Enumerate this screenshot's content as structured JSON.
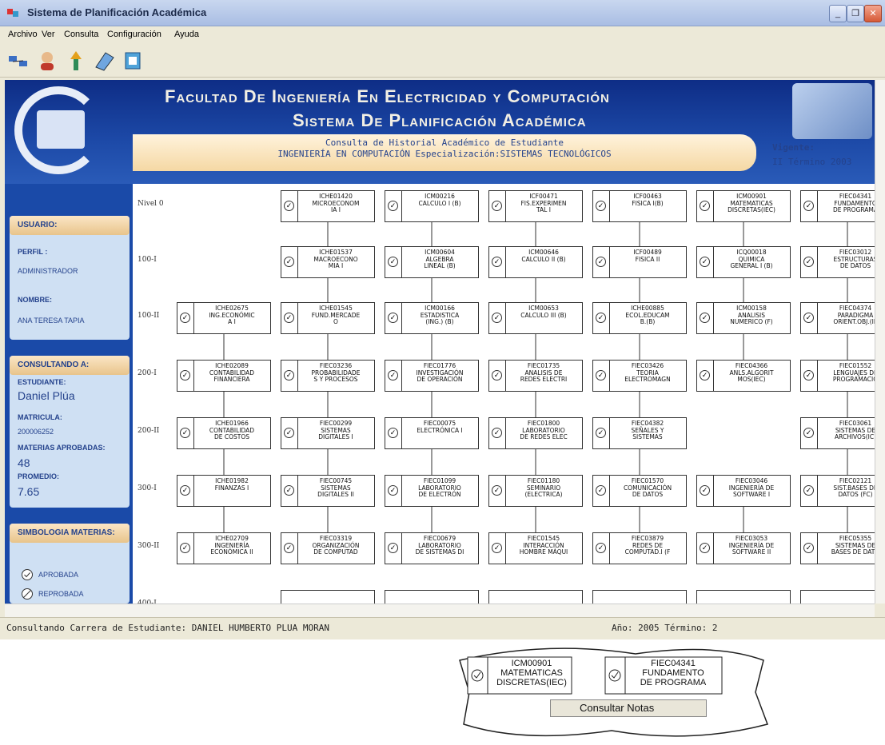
{
  "window": {
    "title": "Sistema de Planificación Académica"
  },
  "menu": [
    "Archivo",
    "Ver",
    "Consulta",
    "Configuración",
    "Ayuda"
  ],
  "header": {
    "line1": "Facultad De Ingeniería En Electricidad y Computación",
    "line2": "Sistema De Planificación Académica",
    "banner1": "Consulta de Historial Académico de Estudiante",
    "banner2": "INGENIERÍA EN COMPUTACIÓN Especialización:SISTEMAS TECNOLÓGICOS",
    "vigente": "Vigente:",
    "term": "II Término 2003"
  },
  "sidebar": {
    "usuario_head": "USUARIO:",
    "perfil_label": "PERFIL :",
    "perfil": "ADMINISTRADOR",
    "nombre_label": "NOMBRE:",
    "nombre": "ANA TERESA TAPIA",
    "consult_head": "CONSULTANDO A:",
    "estudiante_label": "ESTUDIANTE:",
    "estudiante": "Daniel Plúa",
    "matricula_label": "MATRICULA:",
    "matricula": "200006252",
    "aprobadas_label": "MATERIAS APROBADAS:",
    "aprobadas": "48",
    "promedio_label": "PROMEDIO:",
    "promedio": "7.65",
    "simb_head": "SIMBOLOGIA MATERIAS:",
    "aprobada": "APROBADA",
    "reprobada": "REPROBADA"
  },
  "levels": [
    "Nivel 0",
    "100-I",
    "100-II",
    "200-I",
    "200-II",
    "300-I",
    "300-II",
    "400-I"
  ],
  "courses": [
    {
      "code": "ICHE01420",
      "name": "MICROECONOM\nIA I",
      "row": 0,
      "col": 1
    },
    {
      "code": "ICM00216",
      "name": "CALCULO I (B)",
      "row": 0,
      "col": 2
    },
    {
      "code": "ICF00471",
      "name": "FIS.EXPERIMEN\nTAL I",
      "row": 0,
      "col": 3
    },
    {
      "code": "ICF00463",
      "name": "FISICA I(B)",
      "row": 0,
      "col": 4
    },
    {
      "code": "ICM00901",
      "name": "MATEMATICAS\nDISCRETAS(IEC)",
      "row": 0,
      "col": 5
    },
    {
      "code": "FIEC04341",
      "name": "FUNDAMENTO\nDE PROGRAMA",
      "row": 0,
      "col": 6
    },
    {
      "code": "ICHE01537",
      "name": "MACROECONO\nMIA I",
      "row": 1,
      "col": 1
    },
    {
      "code": "ICM00604",
      "name": "ALGEBRA\nLINEAL (B)",
      "row": 1,
      "col": 2
    },
    {
      "code": "ICM00646",
      "name": "CALCULO II (B)",
      "row": 1,
      "col": 3
    },
    {
      "code": "ICF00489",
      "name": "FISICA II",
      "row": 1,
      "col": 4
    },
    {
      "code": "ICQ00018",
      "name": "QUIMICA\nGENERAL I (B)",
      "row": 1,
      "col": 5
    },
    {
      "code": "FIEC03012",
      "name": "ESTRUCTURAS\nDE DATOS",
      "row": 1,
      "col": 6
    },
    {
      "code": "ICHE02675",
      "name": "ING.ECONÓMIC\nA I",
      "row": 2,
      "col": 0
    },
    {
      "code": "ICHE01545",
      "name": "FUND.MERCADE\nO",
      "row": 2,
      "col": 1
    },
    {
      "code": "ICM00166",
      "name": "ESTADISTICA\n(ING.) (B)",
      "row": 2,
      "col": 2
    },
    {
      "code": "ICM00653",
      "name": "CALCULO III (B)",
      "row": 2,
      "col": 3
    },
    {
      "code": "ICHE00885",
      "name": "ECOL.EDUCAM\nB.(B)",
      "row": 2,
      "col": 4
    },
    {
      "code": "ICM00158",
      "name": "ANALISIS\nNUMERICO (F)",
      "row": 2,
      "col": 5
    },
    {
      "code": "FIEC04374",
      "name": "PARADIGMA\nORIENT.OBJ.(IE",
      "row": 2,
      "col": 6
    },
    {
      "code": "ICHE02089",
      "name": "CONTABILIDAD\nFINANCIERA",
      "row": 3,
      "col": 0
    },
    {
      "code": "FIEC03236",
      "name": "PROBABILIDADE\nS Y PROCESOS",
      "row": 3,
      "col": 1
    },
    {
      "code": "FIEC01776",
      "name": "INVESTIGACIÓN\nDE OPERACIÓN",
      "row": 3,
      "col": 2
    },
    {
      "code": "FIEC01735",
      "name": "ANALISIS DE\nREDES ELECTRI",
      "row": 3,
      "col": 3
    },
    {
      "code": "FIEC03426",
      "name": "TEORIA\nELECTROMAGN",
      "row": 3,
      "col": 4
    },
    {
      "code": "FIEC04366",
      "name": "ANLS.ALGORIT\nMOS(IEC)",
      "row": 3,
      "col": 5
    },
    {
      "code": "FIEC01552",
      "name": "LENGUAJES DE\nPROGRAMACIÓ",
      "row": 3,
      "col": 6
    },
    {
      "code": "ICHE01966",
      "name": "CONTABILIDAD\nDE COSTOS",
      "row": 4,
      "col": 0
    },
    {
      "code": "FIEC00299",
      "name": "SISTEMAS\nDIGITALES I",
      "row": 4,
      "col": 1
    },
    {
      "code": "FIEC00075",
      "name": "ELECTRÓNICA I",
      "row": 4,
      "col": 2
    },
    {
      "code": "FIEC01800",
      "name": "LABORATORIO\nDE REDES ELEC",
      "row": 4,
      "col": 3
    },
    {
      "code": "FIEC04382",
      "name": "SEÑALES Y\nSISTEMAS",
      "row": 4,
      "col": 4
    },
    {
      "code": "FIEC03061",
      "name": "SISTEMAS DE\nARCHIVOS(IC)",
      "row": 4,
      "col": 6
    },
    {
      "code": "ICHE01982",
      "name": "FINANZAS I",
      "row": 5,
      "col": 0
    },
    {
      "code": "FIEC00745",
      "name": "SISTEMAS\nDIGITALES II",
      "row": 5,
      "col": 1
    },
    {
      "code": "FIEC01099",
      "name": "LABORATORIO\nDE ELECTRÓN",
      "row": 5,
      "col": 2
    },
    {
      "code": "FIEC01180",
      "name": "SEMINARIO\n(ELECTRICA)",
      "row": 5,
      "col": 3
    },
    {
      "code": "FIEC01570",
      "name": "COMUNICACIÓN\nDE DATOS",
      "row": 5,
      "col": 4
    },
    {
      "code": "FIEC03046",
      "name": "INGENIERÍA DE\nSOFTWARE I",
      "row": 5,
      "col": 5
    },
    {
      "code": "FIEC02121",
      "name": "SIST.BASES DE\nDATOS (FC)",
      "row": 5,
      "col": 6
    },
    {
      "code": "ICHE02709",
      "name": "INGENIERÍA\nECONÓMICA II",
      "row": 6,
      "col": 0
    },
    {
      "code": "FIEC03319",
      "name": "ORGANIZACIÓN\nDE COMPUTAD",
      "row": 6,
      "col": 1
    },
    {
      "code": "FIEC00679",
      "name": "LABORATORIO\nDE SISTEMAS DI",
      "row": 6,
      "col": 2
    },
    {
      "code": "FIEC01545",
      "name": "INTERACCIÓN\nHOMBRE MÁQUI",
      "row": 6,
      "col": 3
    },
    {
      "code": "FIEC03879",
      "name": "REDES DE\nCOMPUTAD.I (F",
      "row": 6,
      "col": 4
    },
    {
      "code": "FIEC03053",
      "name": "INGENIERÍA DE\nSOFTWARE II",
      "row": 6,
      "col": 5
    },
    {
      "code": "FIEC05355",
      "name": "SISTEMAS DE\nBASES DE DATO",
      "row": 6,
      "col": 6
    }
  ],
  "status": {
    "left": "Consultando Carrera de Estudiante: DANIEL HUMBERTO PLUA MORAN",
    "right": "Año: 2005  Término: 2"
  },
  "zoom": {
    "c1_code": "ICM00901",
    "c1_name": "MATEMATICAS\nDISCRETAS(IEC)",
    "c2_code": "FIEC04341",
    "c2_name": "FUNDAMENTO\nDE PROGRAMA",
    "menu_item": "Consultar Notas"
  }
}
